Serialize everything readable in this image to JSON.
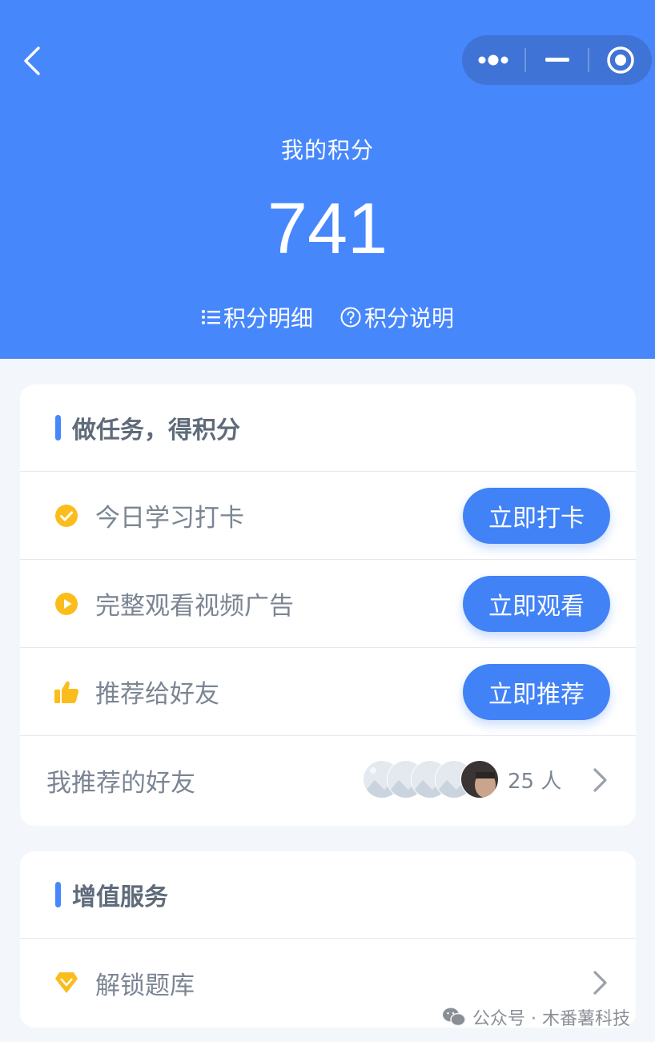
{
  "header": {
    "title": "我的积分",
    "points": "741",
    "details_link": "积分明细",
    "explain_link": "积分说明"
  },
  "tasks": {
    "section_title": "做任务，得积分",
    "items": [
      {
        "label": "今日学习打卡",
        "button": "立即打卡",
        "icon": "check-circle-icon"
      },
      {
        "label": "完整观看视频广告",
        "button": "立即观看",
        "icon": "play-circle-icon"
      },
      {
        "label": "推荐给好友",
        "button": "立即推荐",
        "icon": "thumbs-up-icon"
      }
    ],
    "friends": {
      "label": "我推荐的好友",
      "count": "25 人"
    }
  },
  "services": {
    "section_title": "增值服务",
    "items": [
      {
        "label": "解锁题库",
        "icon": "diamond-icon"
      }
    ]
  },
  "watermark": "公众号 · 木番薯科技",
  "colors": {
    "primary": "#4787fc",
    "accent_yellow": "#fbbd1d",
    "text_gray": "#7b8593"
  }
}
